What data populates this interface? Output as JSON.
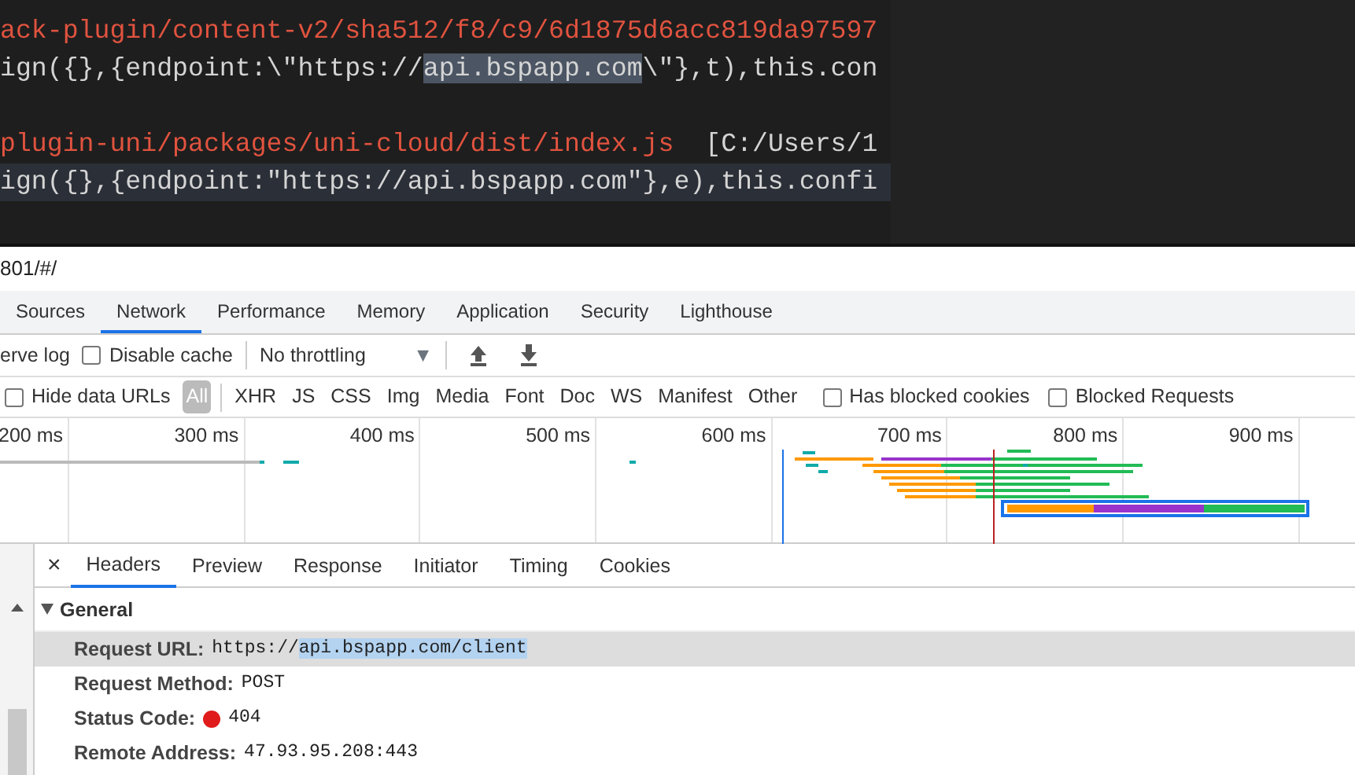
{
  "editor": {
    "lines": [
      {
        "current": false,
        "segments": [
          {
            "kind": "path",
            "text": "ack-plugin/content-v2/sha512/f8/c9/6d1875d6acc819da97597",
            "highlighted": false
          }
        ]
      },
      {
        "current": false,
        "segments": [
          {
            "kind": "code",
            "text": "ign({},{endpoint:\\\"https://",
            "highlighted": false
          },
          {
            "kind": "code",
            "text": "api.bspapp.com",
            "highlighted": true
          },
          {
            "kind": "code",
            "text": "\\\"},t),this.con",
            "highlighted": false
          }
        ]
      },
      {
        "current": false
      },
      {
        "current": false,
        "segments": [
          {
            "kind": "path",
            "text": "plugin-uni/packages/uni-cloud/dist/index.js",
            "highlighted": false
          },
          {
            "kind": "code",
            "text": "[C:/Users/1",
            "highlighted": false
          }
        ]
      },
      {
        "current": true,
        "segments": [
          {
            "kind": "code",
            "text": "ign({},{endpoint:\"https://api.bspapp.com\"},e),this.confi",
            "highlighted": false
          }
        ]
      }
    ]
  },
  "address_bar": {
    "text": "801/#/"
  },
  "tabs": [
    {
      "label": "Sources",
      "selected": false
    },
    {
      "label": "Network",
      "selected": true
    },
    {
      "label": "Performance",
      "selected": false
    },
    {
      "label": "Memory",
      "selected": false
    },
    {
      "label": "Application",
      "selected": false
    },
    {
      "label": "Security",
      "selected": false
    },
    {
      "label": "Lighthouse",
      "selected": false
    }
  ],
  "toolbar": {
    "preserve_log_label": "erve log",
    "disable_cache": {
      "label": "Disable cache",
      "checked": false
    },
    "throttling": "No throttling",
    "throttling_caret": "▼"
  },
  "filter_bar": {
    "hide_data_urls": {
      "label": "Hide data URLs",
      "checked": false
    },
    "types": [
      {
        "label": "All",
        "selected": true
      },
      {
        "label": "XHR",
        "selected": false
      },
      {
        "label": "JS",
        "selected": false
      },
      {
        "label": "CSS",
        "selected": false
      },
      {
        "label": "Img",
        "selected": false
      },
      {
        "label": "Media",
        "selected": false
      },
      {
        "label": "Font",
        "selected": false
      },
      {
        "label": "Doc",
        "selected": false
      },
      {
        "label": "WS",
        "selected": false
      },
      {
        "label": "Manifest",
        "selected": false
      },
      {
        "label": "Other",
        "selected": false
      }
    ],
    "has_blocked_cookies": {
      "label": "Has blocked cookies",
      "checked": false
    },
    "blocked_requests": {
      "label": "Blocked Requests",
      "checked": false
    }
  },
  "timeline": {
    "ticks": [
      "200 ms",
      "300 ms",
      "400 ms",
      "500 ms",
      "600 ms",
      "700 ms",
      "800 ms",
      "900 ms"
    ]
  },
  "details": {
    "close": "×",
    "tabs": [
      {
        "label": "Headers",
        "selected": true
      },
      {
        "label": "Preview",
        "selected": false
      },
      {
        "label": "Response",
        "selected": false
      },
      {
        "label": "Initiator",
        "selected": false
      },
      {
        "label": "Timing",
        "selected": false
      },
      {
        "label": "Cookies",
        "selected": false
      }
    ],
    "section": {
      "title": "General",
      "expanded": true,
      "rows": [
        {
          "name": "Request URL:",
          "value": "https://",
          "value_highlighted": "api.bspapp.com/client",
          "selected": true
        },
        {
          "name": "Request Method:",
          "value": "POST",
          "selected": false
        },
        {
          "name": "Status Code:",
          "value": "404",
          "selected": false,
          "color": "#e01b1b"
        },
        {
          "name": "Remote Address:",
          "value": "47.93.95.208:443",
          "selected": false
        }
      ]
    }
  }
}
